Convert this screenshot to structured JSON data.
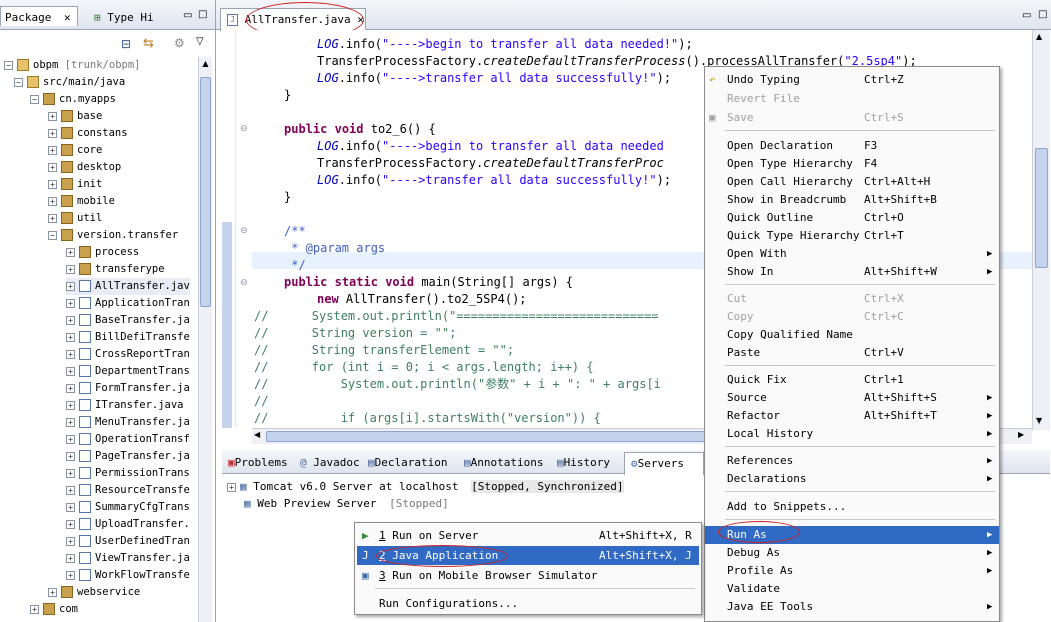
{
  "left_panel": {
    "tab_package": "Package",
    "tab_type_hierarchy": "Type Hi",
    "tree": [
      {
        "label": "obpm",
        "suffix": "[trunk/obpm]"
      },
      {
        "label": "src/main/java"
      },
      {
        "label": "cn.myapps"
      },
      {
        "label": "base"
      },
      {
        "label": "constans"
      },
      {
        "label": "core"
      },
      {
        "label": "desktop"
      },
      {
        "label": "init"
      },
      {
        "label": "mobile"
      },
      {
        "label": "util"
      },
      {
        "label": "version.transfer"
      },
      {
        "label": "process"
      },
      {
        "label": "transferype"
      },
      {
        "label": "AllTransfer.jav"
      },
      {
        "label": "ApplicationTran"
      },
      {
        "label": "BaseTransfer.ja"
      },
      {
        "label": "BillDefiTransfe"
      },
      {
        "label": "CrossReportTran"
      },
      {
        "label": "DepartmentTrans"
      },
      {
        "label": "FormTransfer.ja"
      },
      {
        "label": "ITransfer.java"
      },
      {
        "label": "MenuTransfer.ja"
      },
      {
        "label": "OperationTransf"
      },
      {
        "label": "PageTransfer.ja"
      },
      {
        "label": "PermissionTrans"
      },
      {
        "label": "ResourceTransfe"
      },
      {
        "label": "SummaryCfgTrans"
      },
      {
        "label": "UploadTransfer."
      },
      {
        "label": "UserDefinedTran"
      },
      {
        "label": "ViewTransfer.ja"
      },
      {
        "label": "WorkFlowTransfe"
      },
      {
        "label": "webservice"
      },
      {
        "label": "com"
      }
    ]
  },
  "editor": {
    "tab_title": "AllTransfer.java",
    "code": {
      "l1_call": "LOG",
      "l1_str": "\"---->begin to transfer all data needed!\"",
      "l2_a": "TransferProcessFactory.",
      "l2_b": "createDefaultTransferProcess",
      "l2_c": "().processAllTransfer(",
      "l2_d": "\"2.5sp4\"",
      "l2_e": ");",
      "l3_str": "\"---->transfer all data successfully!\"",
      "kw_public": "public",
      "kw_void": "void",
      "kw_static": "static",
      "kw_new": "new",
      "kw_for": "for",
      "kw_int": "int",
      "kw_if": "if",
      "m_to26": " to2_6() {",
      "l7_str": "\"---->begin to transfer all data needed",
      "l8_a": "TransferProcessFactory.",
      "l8_b": "createDefaultTransferProc",
      "jd1": "/**",
      "jd2": " * @param args",
      "jd3": " */",
      "main_sig": " main(String[] args) {",
      "new_line": " AllTransfer().to2_5SP4();",
      "c1": "//      System.out.println(\"============================",
      "c2": "//      String version = \"\";",
      "c3": "//      String transferElement = \"\";",
      "c4": "//      for (int i = 0; i < args.length; i++) {",
      "c5": "//          System.out.println(\"参数\" + i + \": \" + args[i",
      "c6": "//",
      "c7": "//          if (args[i].startsWith(\"version\")) {",
      "brace": "}",
      "info_call": ".info(",
      "info_end": ");"
    }
  },
  "bottom": {
    "tabs": [
      "Problems",
      "Javadoc",
      "Declaration",
      "Annotations",
      "History",
      "Servers"
    ],
    "servers": [
      {
        "name": "Tomcat v6.0 Server at localhost",
        "status": "[Stopped, Synchronized]"
      },
      {
        "name": "Web Preview Server",
        "status": "[Stopped]"
      }
    ]
  },
  "context_menu": {
    "items": [
      {
        "label": "Undo Typing",
        "accel": "Ctrl+Z"
      },
      {
        "label": "Revert File",
        "accel": ""
      },
      {
        "label": "Save",
        "accel": "Ctrl+S"
      },
      {
        "label": "Open Declaration",
        "accel": "F3"
      },
      {
        "label": "Open Type Hierarchy",
        "accel": "F4"
      },
      {
        "label": "Open Call Hierarchy",
        "accel": "Ctrl+Alt+H"
      },
      {
        "label": "Show in Breadcrumb",
        "accel": "Alt+Shift+B"
      },
      {
        "label": "Quick Outline",
        "accel": "Ctrl+O"
      },
      {
        "label": "Quick Type Hierarchy",
        "accel": "Ctrl+T"
      },
      {
        "label": "Open With",
        "accel": ""
      },
      {
        "label": "Show In",
        "accel": "Alt+Shift+W"
      },
      {
        "label": "Cut",
        "accel": "Ctrl+X"
      },
      {
        "label": "Copy",
        "accel": "Ctrl+C"
      },
      {
        "label": "Copy Qualified Name",
        "accel": ""
      },
      {
        "label": "Paste",
        "accel": "Ctrl+V"
      },
      {
        "label": "Quick Fix",
        "accel": "Ctrl+1"
      },
      {
        "label": "Source",
        "accel": "Alt+Shift+S"
      },
      {
        "label": "Refactor",
        "accel": "Alt+Shift+T"
      },
      {
        "label": "Local History",
        "accel": ""
      },
      {
        "label": "References",
        "accel": ""
      },
      {
        "label": "Declarations",
        "accel": ""
      },
      {
        "label": "Add to Snippets...",
        "accel": ""
      },
      {
        "label": "Run As",
        "accel": ""
      },
      {
        "label": "Debug As",
        "accel": ""
      },
      {
        "label": "Profile As",
        "accel": ""
      },
      {
        "label": "Validate",
        "accel": ""
      },
      {
        "label": "Java EE Tools",
        "accel": ""
      }
    ]
  },
  "submenu": {
    "items": [
      {
        "num": "1",
        "label": "Run on Server",
        "accel": "Alt+Shift+X, R"
      },
      {
        "num": "2",
        "label": "Java Application",
        "accel": "Alt+Shift+X, J"
      },
      {
        "num": "3",
        "label": "Run on Mobile Browser Simulator",
        "accel": ""
      },
      {
        "num": "",
        "label": "Run Configurations...",
        "accel": ""
      }
    ]
  },
  "colors": {
    "highlight": "#316ac5",
    "keyword": "#7f0055",
    "string": "#2a00ff",
    "comment": "#3f7f5f",
    "annotation_ellipse": "#d02020"
  }
}
